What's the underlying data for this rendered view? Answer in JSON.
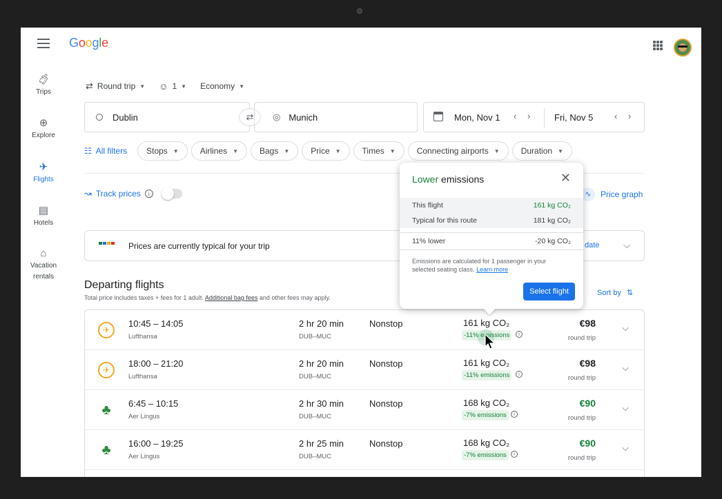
{
  "app": {
    "logo": "Google"
  },
  "nav": [
    {
      "label": "Trips",
      "icon": "luggage-icon"
    },
    {
      "label": "Explore",
      "icon": "explore-icon"
    },
    {
      "label": "Flights",
      "icon": "airplane-icon"
    },
    {
      "label": "Hotels",
      "icon": "bed-icon"
    },
    {
      "label": "Vacation rentals",
      "icon": "house-icon"
    }
  ],
  "search": {
    "trip_type": "Round trip",
    "passengers": "1",
    "cabin": "Economy",
    "origin": "Dublin",
    "destination": "Munich",
    "depart_date": "Mon, Nov 1",
    "return_date": "Fri, Nov 5"
  },
  "filters": {
    "all_filters": "All filters",
    "chips": [
      "Stops",
      "Airlines",
      "Bags",
      "Price",
      "Times",
      "Connecting airports",
      "Duration"
    ]
  },
  "track": {
    "label": "Track prices"
  },
  "price_graph": {
    "label": "Price graph"
  },
  "price_insight": {
    "text": "Prices are currently typical for your trip",
    "link_fragment": "date"
  },
  "departing": {
    "title": "Departing flights",
    "subtitle_pre": "Total price includes taxes + fees for 1 adult. ",
    "subtitle_link": "Additional bag fees",
    "subtitle_post": " and other fees may apply.",
    "sort_label": "Sort by"
  },
  "flights": [
    {
      "times": "10:45 – 14:05",
      "airline": "Lufthansa",
      "duration": "2 hr 20 min",
      "route": "DUB–MUC",
      "stops": "Nonstop",
      "co2": "161 kg CO₂",
      "emissions": "-11% emissions",
      "price": "€98",
      "price_note": "round trip",
      "cheapest": false
    },
    {
      "times": "18:00 – 21:20",
      "airline": "Lufthansa",
      "duration": "2 hr 20 min",
      "route": "DUB–MUC",
      "stops": "Nonstop",
      "co2": "161 kg CO₂",
      "emissions": "-11% emissions",
      "price": "€98",
      "price_note": "round trip",
      "cheapest": false
    },
    {
      "times": "6:45 – 10:15",
      "airline": "Aer Lingus",
      "duration": "2 hr 30 min",
      "route": "DUB–MUC",
      "stops": "Nonstop",
      "co2": "168 kg CO₂",
      "emissions": "-7% emissions",
      "price": "€90",
      "price_note": "round trip",
      "cheapest": true
    },
    {
      "times": "16:00 – 19:25",
      "airline": "Aer Lingus",
      "duration": "2 hr 25 min",
      "route": "DUB–MUC",
      "stops": "Nonstop",
      "co2": "168 kg CO₂",
      "emissions": "-7% emissions",
      "price": "€90",
      "price_note": "round trip",
      "cheapest": true
    }
  ],
  "popup": {
    "title_highlight": "Lower",
    "title_rest": " emissions",
    "rows": [
      {
        "label": "This flight",
        "value": "161 kg CO₂"
      },
      {
        "label": "Typical for this route",
        "value": "181 kg CO₂"
      },
      {
        "label": "11% lower",
        "value": "-20 kg CO₂"
      }
    ],
    "note": "Emissions are calculated for 1 passenger in your selected seating class. ",
    "note_link": "Learn more",
    "button": "Select flight"
  },
  "colors": {
    "accent": "#1a73e8",
    "green": "#188038",
    "green_bg": "#e6f4ea"
  }
}
